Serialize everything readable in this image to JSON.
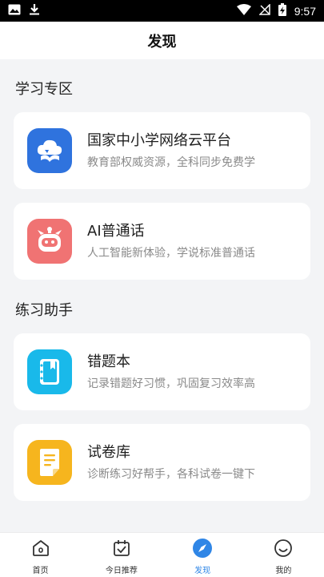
{
  "status_bar": {
    "time": "9:57"
  },
  "page": {
    "title": "发现"
  },
  "sections": [
    {
      "title": "学习专区",
      "cards": [
        {
          "title": "国家中小学网络云平台",
          "subtitle": "教育部权威资源，全科同步免费学",
          "icon": "cloud-book-icon",
          "color": "#2f73de"
        },
        {
          "title": "AI普通话",
          "subtitle": "人工智能新体验，学说标准普通话",
          "icon": "robot-icon",
          "color": "#f07373"
        }
      ]
    },
    {
      "title": "练习助手",
      "cards": [
        {
          "title": "错题本",
          "subtitle": "记录错题好习惯，巩固复习效率高",
          "icon": "notebook-icon",
          "color": "#19b9ea"
        },
        {
          "title": "试卷库",
          "subtitle": "诊断练习好帮手，各科试卷一键下",
          "icon": "paper-icon",
          "color": "#f6b51e"
        }
      ]
    }
  ],
  "tabs": [
    {
      "label": "首页",
      "icon": "home-icon",
      "active": false
    },
    {
      "label": "今日推荐",
      "icon": "calendar-check-icon",
      "active": false
    },
    {
      "label": "发现",
      "icon": "compass-icon",
      "active": true
    },
    {
      "label": "我的",
      "icon": "smile-face-icon",
      "active": false
    }
  ],
  "colors": {
    "accent": "#2f86e6",
    "background": "#f3f4f6"
  }
}
